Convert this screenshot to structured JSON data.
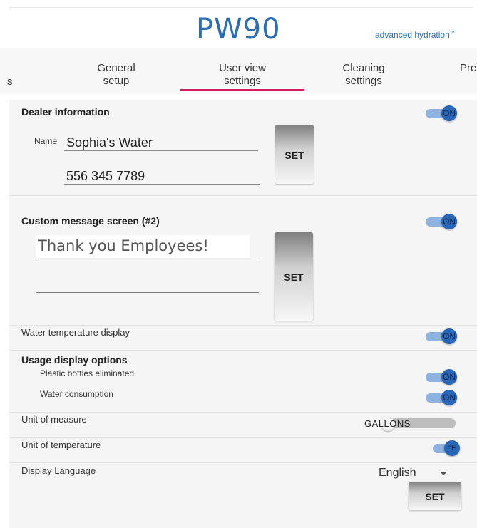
{
  "header": {
    "logo": "PW90",
    "tagline": "advanced hydration",
    "tm": "™"
  },
  "tabs": [
    {
      "line1": "s",
      "line2": ""
    },
    {
      "line1": "General",
      "line2": "setup"
    },
    {
      "line1": "User view",
      "line2": "settings"
    },
    {
      "line1": "Cleaning",
      "line2": "settings"
    },
    {
      "line1": "Pre",
      "line2": ""
    }
  ],
  "active_tab_index": 2,
  "dealer": {
    "heading": "Dealer information",
    "toggle": "ON",
    "name_label": "Name",
    "name_value": "Sophia's Water",
    "phone_value": "556 345 7789",
    "set_label": "SET"
  },
  "custom_message": {
    "heading": "Custom message screen (#2)",
    "toggle": "ON",
    "line1": "Thank you Employees!",
    "line2": "",
    "set_label": "SET"
  },
  "water_temp": {
    "label": "Water temperature display",
    "toggle": "ON"
  },
  "usage": {
    "heading": "Usage display options",
    "bottles_label": "Plastic bottles eliminated",
    "bottles_toggle": "ON",
    "consumption_label": "Water consumption",
    "consumption_toggle": "ON"
  },
  "unit_measure": {
    "label": "Unit of measure",
    "value": "GALLONS"
  },
  "unit_temp": {
    "label": "Unit of temperature",
    "value": "°F"
  },
  "language": {
    "label": "Display Language",
    "value": "English",
    "set_label": "SET"
  },
  "colors": {
    "brand": "#2a6fb6",
    "tab_indicator": "#d81b60",
    "toggle_on": "#2a66b8"
  }
}
